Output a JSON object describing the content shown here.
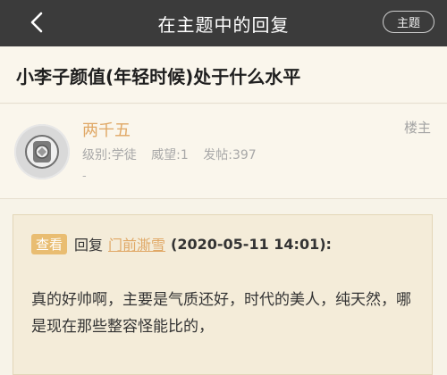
{
  "header": {
    "title": "在主题中的回复",
    "topic_button": "主题"
  },
  "post": {
    "title": "小李子颜值(年轻时候)处于什么水平"
  },
  "author": {
    "name": "两千五",
    "level": "级别:学徒",
    "reputation": "威望:1",
    "posts": "发帖:397",
    "signature": "-",
    "tag": "楼主"
  },
  "quote": {
    "view_label": "查看",
    "reply_word": "回复",
    "quoted_user": "门前澌雪",
    "timestamp": "(2020-05-11 14:01):",
    "body": "真的好帅啊，主要是气质还好，时代的美人，纯天然，哪是现在那些整容怪能比的，"
  },
  "colors": {
    "header_bg": "#3b3b3b",
    "accent": "#e0a866",
    "view_badge": "#e9bd72",
    "page_bg": "#f7f3e8"
  }
}
